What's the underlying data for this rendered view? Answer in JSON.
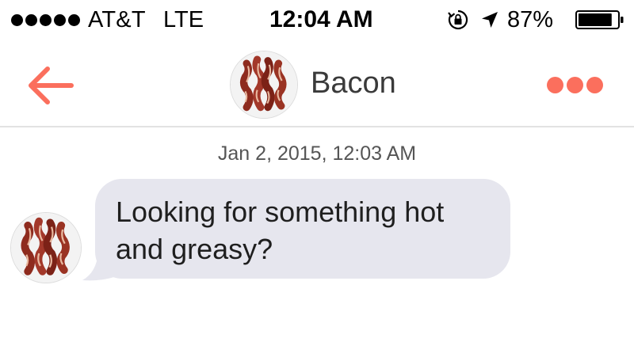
{
  "status_bar": {
    "carrier": "AT&T",
    "network": "LTE",
    "time": "12:04 AM",
    "battery_percent": "87%",
    "icons": [
      "signal-dots-icon",
      "rotation-lock-icon",
      "location-arrow-icon",
      "battery-icon"
    ],
    "battery_level": 0.87
  },
  "nav": {
    "back_icon": "arrow-left-icon",
    "title": "Bacon",
    "more_icon": "more-dots-icon",
    "accent_color": "#fb6f5d"
  },
  "conversation": {
    "timestamp": "Jan 2, 2015, 12:03 AM",
    "messages": [
      {
        "sender": "Bacon",
        "lines": [
          "Looking for something hot",
          "and greasy?"
        ],
        "bubble_color": "#e6e6ee"
      }
    ]
  }
}
